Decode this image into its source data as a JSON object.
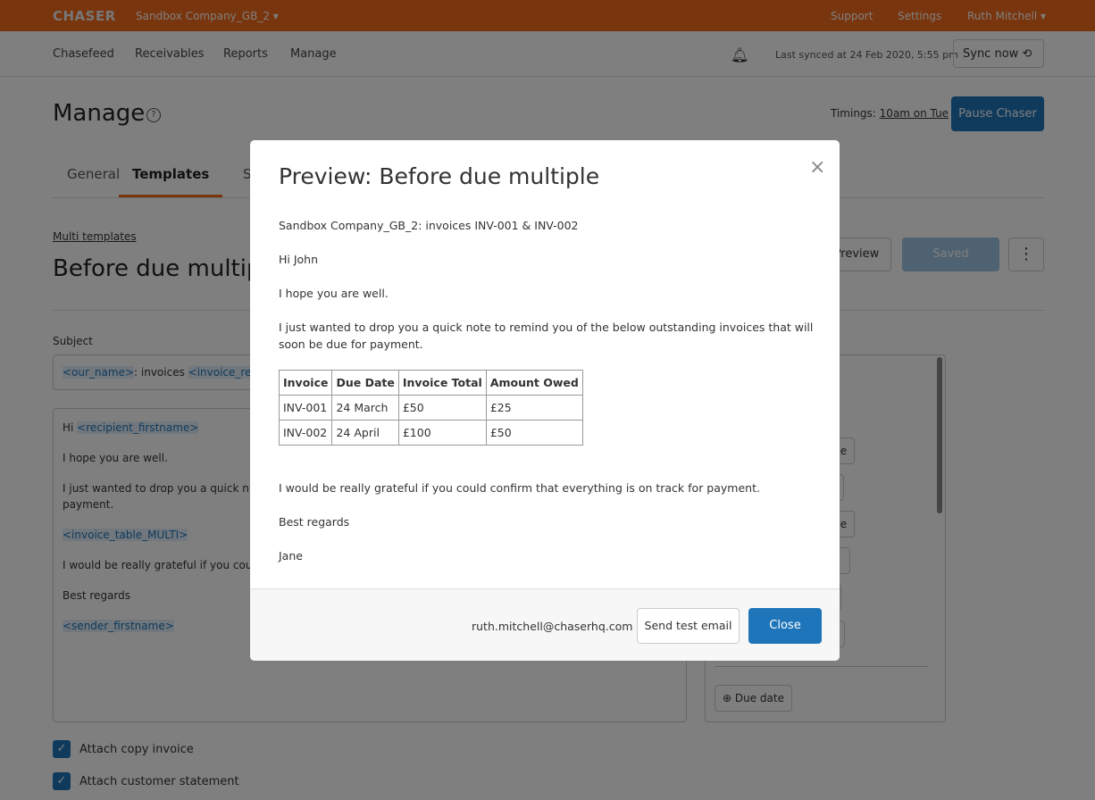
{
  "topbar": {
    "logo": "CHASER",
    "company": "Sandbox Company_GB_2 ▾",
    "support": "Support",
    "settings": "Settings",
    "user": "Ruth Mitchell ▾"
  },
  "nav": {
    "items": [
      "Chasefeed",
      "Receivables",
      "Reports",
      "Manage"
    ],
    "last_synced": "Last synced at 24 Feb 2020, 5:55 pm",
    "sync": "Sync now ⟲"
  },
  "page": {
    "title": "Manage",
    "help": "?",
    "timings_label": "Timings:",
    "timings_value": "10am on Tue",
    "pause": "Pause Chaser",
    "tabs": [
      "General",
      "Templates",
      "S"
    ],
    "back": "Multi templates",
    "template_title": "Before due multip",
    "preview": "Preview",
    "saved": "Saved",
    "more": "⋮",
    "subject_label": "Subject",
    "subject_prefix": "<our_name>",
    "subject_text": ": invoices ",
    "subject_tag2": "<invoice_refe",
    "body": {
      "hi": "Hi ",
      "recipient": "<recipient_firstname>",
      "l1": "I hope you are well.",
      "l2": "I just wanted to drop you a quick n",
      "l2b": "payment.",
      "table": "<invoice_table_MULTI>",
      "l3": "I would be really grateful if you cou",
      "l4": "Best regards",
      "sender": "<sender_firstname>"
    },
    "chips": [
      "me",
      "e",
      "me",
      "e",
      "",
      "",
      "Due date"
    ],
    "attach_invoice": "Attach copy invoice",
    "attach_statement": "Attach customer statement"
  },
  "modal": {
    "title": "Preview: Before due multiple",
    "subject": "Sandbox Company_GB_2: invoices INV-001 & INV-002",
    "greeting": "Hi John",
    "p1": "I hope you are well.",
    "p2": "I just wanted to drop you a quick note to remind you of the below outstanding invoices that will soon be due for payment.",
    "table": {
      "headers": [
        "Invoice",
        "Due Date",
        "Invoice Total",
        "Amount Owed"
      ],
      "rows": [
        [
          "INV-001",
          "24 March",
          "£50",
          "£25"
        ],
        [
          "INV-002",
          "24 April",
          "£100",
          "£50"
        ]
      ]
    },
    "p3": "I would be really grateful if you could confirm that everything is on track for payment.",
    "signoff": "Best regards",
    "sender": "Jane",
    "email": "ruth.mitchell@chaserhq.com",
    "send_test": "Send test email",
    "close": "Close",
    "close_icon": "×"
  }
}
